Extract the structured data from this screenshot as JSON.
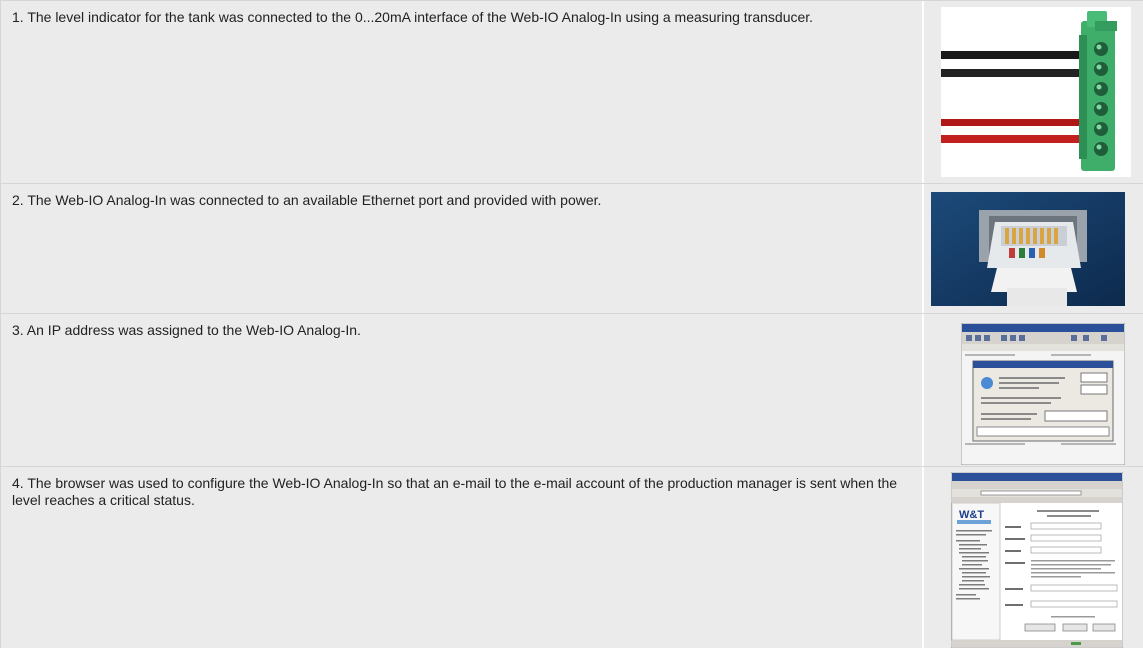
{
  "steps": [
    {
      "text": "1. The level indicator for the tank was connected to the 0...20mA interface of the Web-IO Analog-In using a measuring transducer.",
      "image_icon": "terminal-block-connector-photo"
    },
    {
      "text": "2. The Web-IO Analog-In was connected to an available Ethernet port and provided with power.",
      "image_icon": "ethernet-plug-photo"
    },
    {
      "text": "3. An IP address was assigned to the Web-IO Analog-In.",
      "image_icon": "ip-address-dialog-screenshot"
    },
    {
      "text": "4. The browser was used to configure the Web-IO Analog-In so that an e-mail to the e-mail account of the production manager is sent when the level reaches a critical status.",
      "image_icon": "browser-configuration-screenshot"
    }
  ],
  "colors": {
    "cell_bg": "#ebebeb",
    "border": "#d6d6d6",
    "text": "#222222",
    "connector_green": "#3fae6a"
  }
}
